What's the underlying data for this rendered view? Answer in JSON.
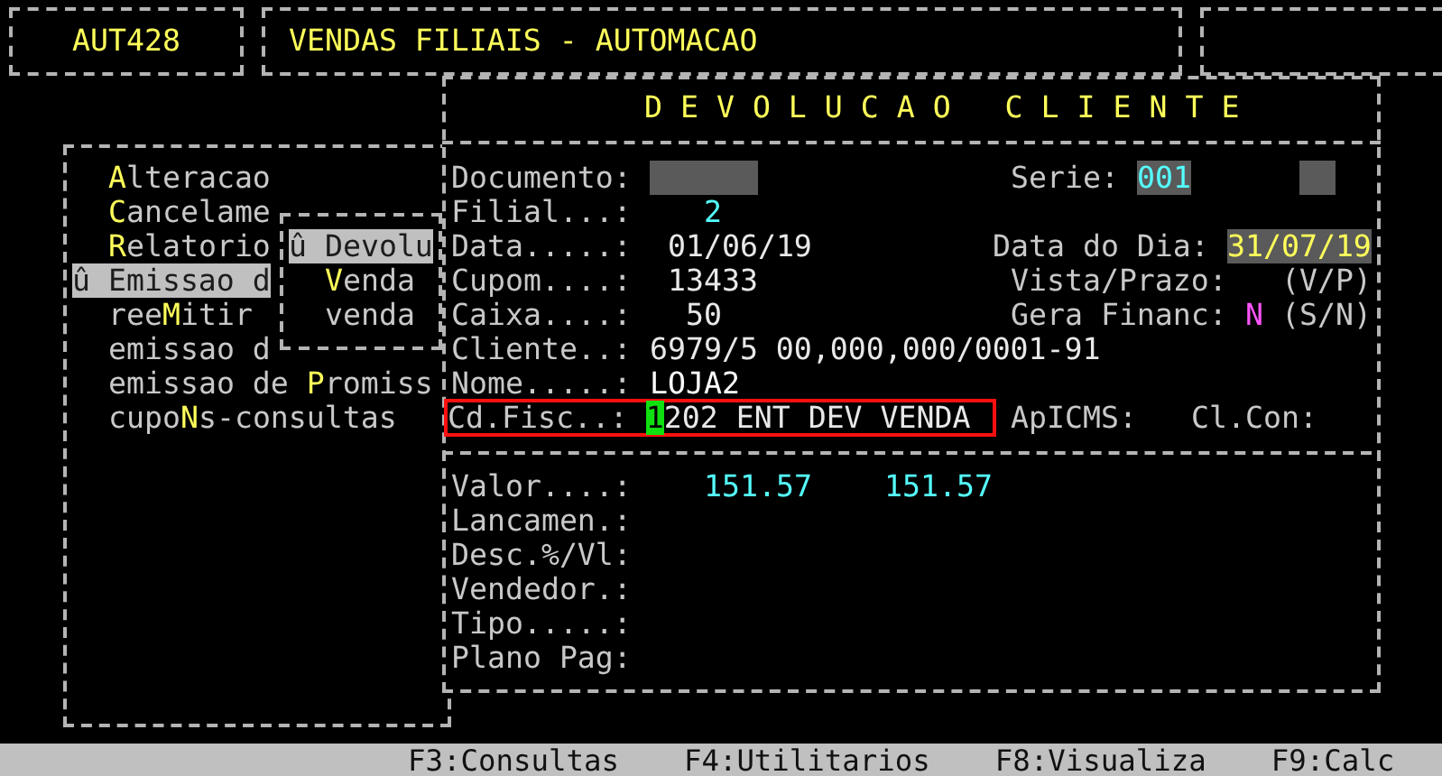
{
  "header": {
    "program_code": "AUT428",
    "title": "VENDAS FILIAIS - AUTOMACAO"
  },
  "menu": {
    "items": [
      {
        "hotkey": "A",
        "after": "lteracao",
        "selected": false
      },
      {
        "hotkey": "C",
        "after": "ancelame",
        "selected": false
      },
      {
        "hotkey": "R",
        "after": "elatorio",
        "selected": false
      },
      {
        "before": "û Emissao d",
        "selected": true
      },
      {
        "before": "ree",
        "hotkey": "M",
        "after": "itir",
        "selected": false
      },
      {
        "before": "emissao d",
        "selected": false
      },
      {
        "before": "emissao de ",
        "hotkey": "P",
        "after": "romiss",
        "selected": false
      },
      {
        "before": "cupo",
        "hotkey": "N",
        "after": "s-consultas",
        "selected": false
      }
    ]
  },
  "submenu": {
    "items": [
      {
        "before": "û Devolu",
        "selected": true
      },
      {
        "hotkey": "V",
        "after": "enda",
        "selected": false
      },
      {
        "before": "venda",
        "selected": false
      }
    ]
  },
  "dialog": {
    "title": "D E V O L U C A O   C L I E N T E",
    "documento": {
      "label": "Documento:"
    },
    "serie": {
      "label": "Serie:",
      "value": "001"
    },
    "filial": {
      "label": "Filial...:",
      "value": "2"
    },
    "data": {
      "label": "Data.....:",
      "value": "01/06/19"
    },
    "data_do_dia": {
      "label": "Data do Dia:",
      "value": "31/07/19"
    },
    "cupom": {
      "label": "Cupom....:",
      "value": "13433"
    },
    "vista_prazo": {
      "label": "Vista/Prazo:",
      "hint": "(V/P)"
    },
    "caixa": {
      "label": "Caixa....:",
      "value": "50"
    },
    "gera_financ": {
      "label": "Gera Financ:",
      "value": "N",
      "hint": "(S/N)"
    },
    "cliente": {
      "label": "Cliente..:",
      "value": "6979/5 00,000,000/0001-91"
    },
    "nome": {
      "label": "Nome.....:",
      "value": "LOJA2"
    },
    "cd_fisc": {
      "label": "Cd.Fisc..:",
      "value": "1202 ENT DEV VENDA",
      "cursor": true,
      "highlighted": true
    },
    "apicms": {
      "label": "ApICMS:"
    },
    "cl_con": {
      "label": "Cl.Con:"
    },
    "valor": {
      "label": "Valor....:",
      "value": "151.57",
      "value_2": "151.57"
    },
    "extra_fields": [
      {
        "label": "Lancamen.:"
      },
      {
        "label": "Desc.%/Vl:"
      },
      {
        "label": "Vendedor.:"
      },
      {
        "label": "Tipo.....:"
      },
      {
        "label": "Plano Pag:"
      }
    ]
  },
  "function_keys": [
    "F3:Consultas",
    "F4:Utilitarios",
    "F8:Visualiza",
    "F9:Calc"
  ]
}
